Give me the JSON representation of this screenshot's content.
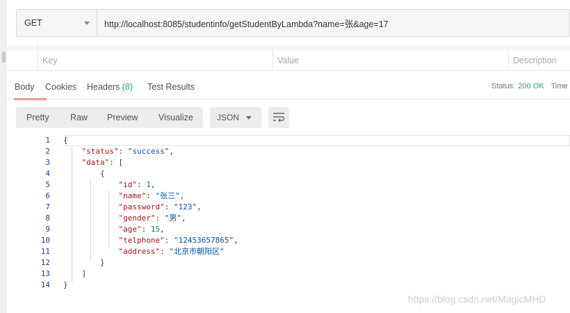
{
  "request": {
    "method": "GET",
    "url": "http://localhost:8085/studentinfo/getStudentByLambda?name=张&age=17"
  },
  "params": {
    "headers": [
      "Key",
      "Value",
      "Description"
    ]
  },
  "response_tabs": {
    "body": "Body",
    "cookies": "Cookies",
    "headers": "Headers",
    "headers_count": "(8)",
    "test_results": "Test Results"
  },
  "status": {
    "label": "Status:",
    "value": "200 OK",
    "time_label": "Time"
  },
  "view": {
    "options": [
      "Pretty",
      "Raw",
      "Preview",
      "Visualize"
    ],
    "format": "JSON"
  },
  "response_body": {
    "status": "success",
    "data": [
      {
        "id": 1,
        "name": "张三",
        "password": "123",
        "gender": "男",
        "age": 15,
        "telphone": "12453657865",
        "address": "北京市朝阳区"
      }
    ]
  },
  "watermark": "https://blog.csdn.net/MagicMHD",
  "colors": {
    "accent_orange": "#f26b3a",
    "status_green": "#26a65b",
    "line_number_blue": "#1c3f94",
    "json_key": "#a31515",
    "json_string": "#0451a5",
    "json_number": "#098658"
  }
}
